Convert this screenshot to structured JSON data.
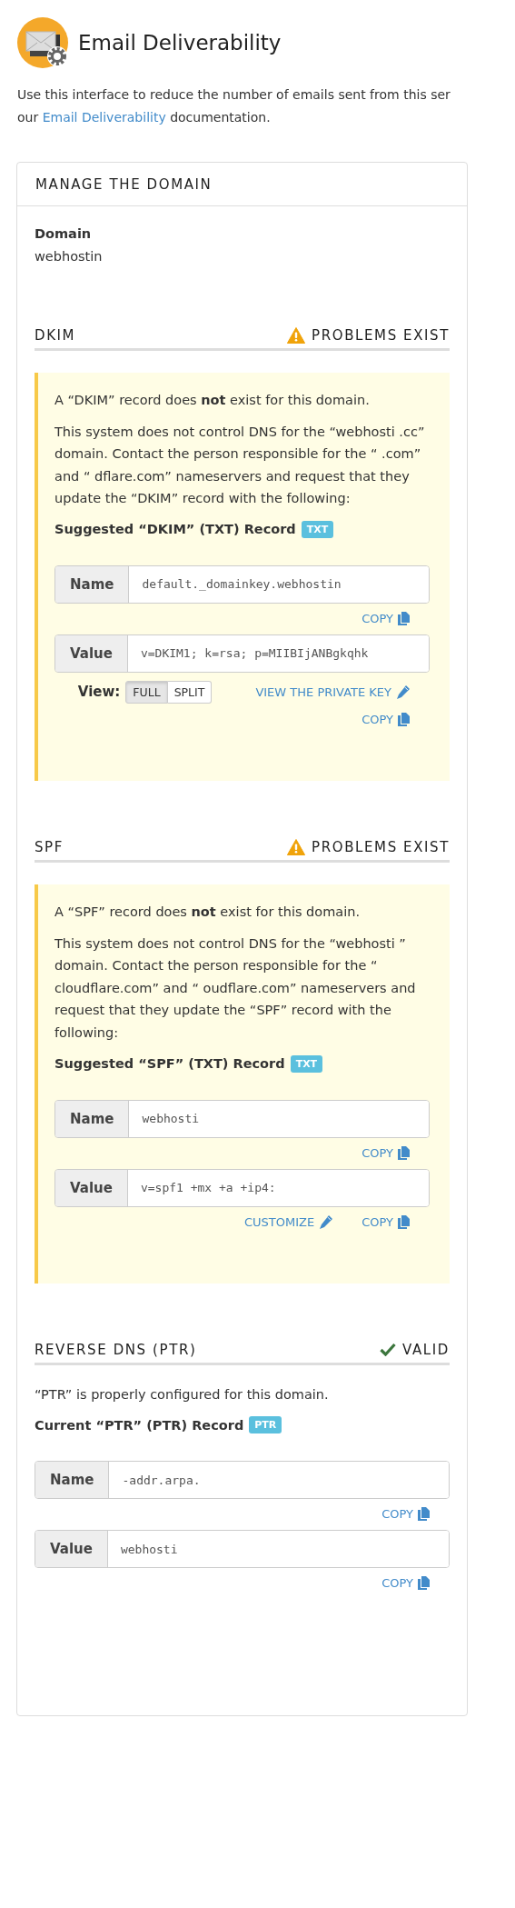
{
  "title": "Email Deliverability",
  "intro": {
    "line_1": "Use this interface to reduce the number of emails sent from this ser",
    "line_2_start": "our",
    "link": "Email Deliverability",
    "line_2_end": "documentation."
  },
  "card": {
    "title": "MANAGE THE DOMAIN",
    "domain_label": "Domain",
    "domain_value": "webhostin",
    "sections": [
      {
        "kind": "problems",
        "heading": "DKIM",
        "status": {
          "kind": "warning",
          "text": "PROBLEMS EXIST"
        },
        "messages": [
          "A “DKIM” record does **not** exist for this domain.",
          "This system does not control DNS for the “webhosti .cc” domain. Contact the person responsible for the “ .com” and “ dflare.com” nameservers and request that they update the “DKIM” record with the following:"
        ],
        "record_title": "Suggested “DKIM” (TXT) Record",
        "badge": "TXT",
        "fields": [
          {
            "label": "Name",
            "value": "default._domainkey.webhostin",
            "action_rows": [
              [
                {
                  "kind": "copy",
                  "text": "COPY"
                }
              ]
            ]
          },
          {
            "label": "Value",
            "value": "v=DKIM1; k=rsa; p=MIIBIjANBgkqhk",
            "action_rows": [
              [
                {
                  "kind": "toggle",
                  "label": "View:",
                  "options": [
                    {
                      "text": "FULL",
                      "selected": true
                    },
                    {
                      "text": "SPLIT",
                      "selected": false
                    }
                  ]
                },
                {
                  "kind": "edit",
                  "text": "VIEW THE PRIVATE KEY"
                }
              ],
              [
                {
                  "kind": "copy",
                  "text": "COPY"
                }
              ]
            ]
          }
        ]
      },
      {
        "kind": "problems",
        "heading": "SPF",
        "status": {
          "kind": "warning",
          "text": "PROBLEMS EXIST"
        },
        "messages": [
          "A “SPF” record does **not** exist for this domain.",
          "This system does not control DNS for the “webhosti ” domain. Contact the person responsible for the “ cloudflare.com” and “ oudflare.com” nameservers and request that they update the “SPF” record with the following:"
        ],
        "record_title": "Suggested “SPF” (TXT) Record",
        "badge": "TXT",
        "fields": [
          {
            "label": "Name",
            "value": "webhosti",
            "action_rows": [
              [
                {
                  "kind": "copy",
                  "text": "COPY"
                }
              ]
            ]
          },
          {
            "label": "Value",
            "value": "v=spf1 +mx +a +ip4:",
            "action_rows": [
              [
                {
                  "kind": "edit",
                  "text": "CUSTOMIZE"
                },
                {
                  "kind": "copy",
                  "text": "COPY"
                }
              ]
            ]
          }
        ]
      },
      {
        "kind": "ok",
        "heading": "REVERSE DNS (PTR)",
        "status": {
          "kind": "valid",
          "text": "VALID"
        },
        "messages": [
          "“PTR” is properly configured for this domain."
        ],
        "record_title": "Current “PTR” (PTR) Record",
        "badge": "PTR",
        "fields": [
          {
            "label": "Name",
            "value": "-addr.arpa.",
            "action_rows": [
              [
                {
                  "kind": "copy",
                  "text": "COPY"
                }
              ]
            ]
          },
          {
            "label": "Value",
            "value": "webhosti",
            "action_rows": [
              [
                {
                  "kind": "copy",
                  "text": "COPY"
                }
              ]
            ]
          }
        ]
      }
    ]
  }
}
